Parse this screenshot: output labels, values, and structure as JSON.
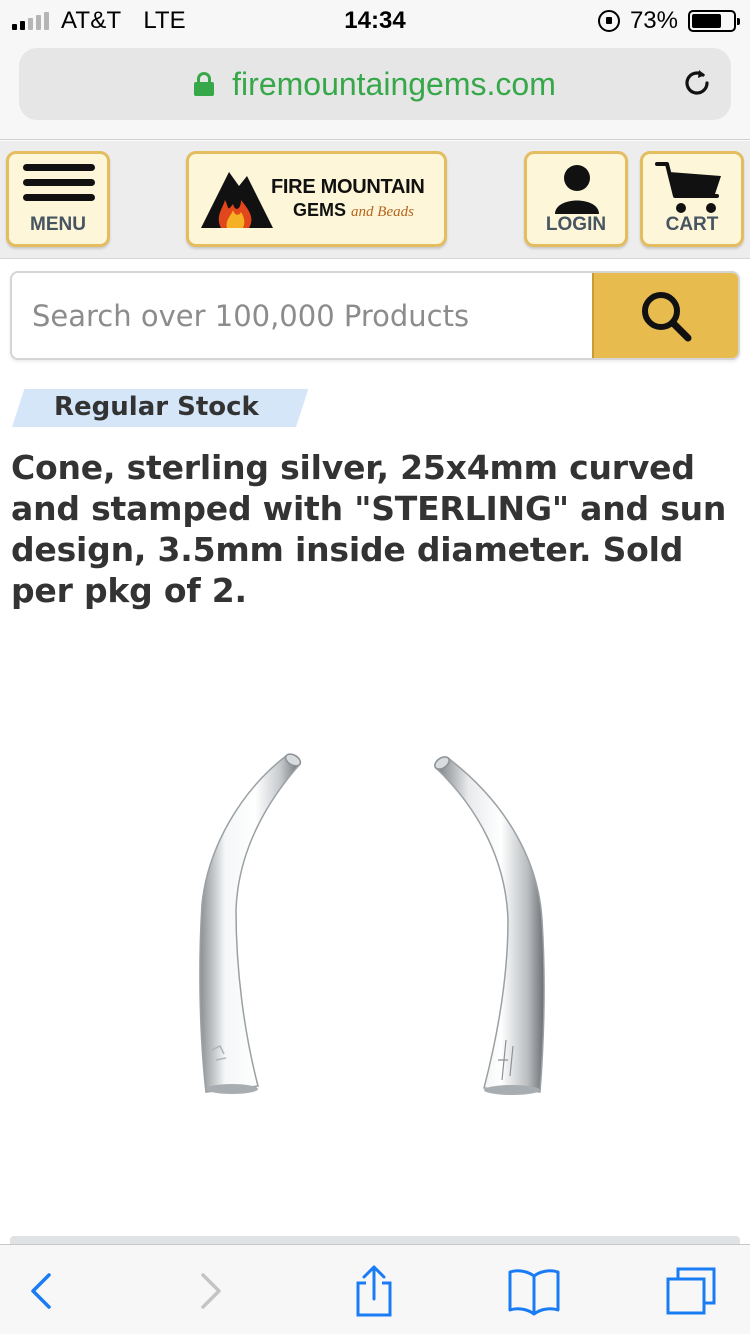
{
  "status_bar": {
    "carrier": "AT&T",
    "network": "LTE",
    "time": "14:34",
    "battery_percent": "73%",
    "battery_level": 0.73,
    "signal_bars": 2,
    "icons": [
      "signal-icon",
      "rotation-lock-icon",
      "battery-icon"
    ]
  },
  "browser": {
    "url": "firemountaingems.com",
    "url_secure": true,
    "accent_color": "#37a84a"
  },
  "header": {
    "menu_label": "MENU",
    "logo_line1": "FIRE MOUNTAIN",
    "logo_line2": "GEMS",
    "logo_script": "and Beads",
    "login_label": "LOGIN",
    "cart_label": "CART",
    "button_color": "#fdf6d8",
    "button_border": "#e3bd5f"
  },
  "search": {
    "placeholder": "Search over 100,000 Products",
    "value": "",
    "button_color": "#e8bb4f"
  },
  "product": {
    "stock_badge": "Regular Stock",
    "title": "Cone, sterling silver, 25x4mm curved and stamped with \"STERLING\" and sun design, 3.5mm inside diameter. Sold per pkg of 2.",
    "image_alt": "two curved sterling silver cones"
  },
  "toolbar": {
    "items": [
      "back-icon",
      "forward-icon",
      "share-icon",
      "bookmarks-icon",
      "tabs-icon"
    ],
    "tint_color": "#1a7cf5"
  }
}
